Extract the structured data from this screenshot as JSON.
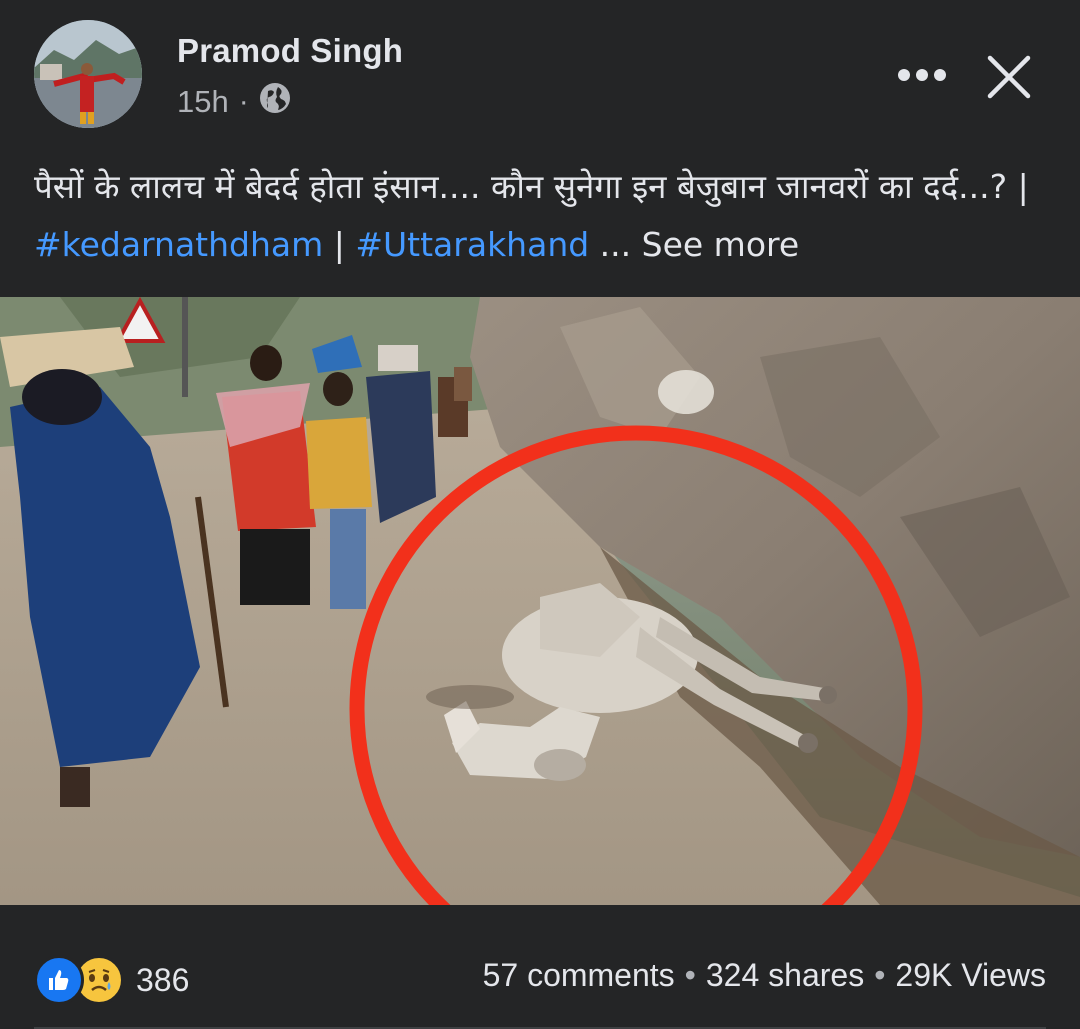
{
  "post": {
    "author": "Pramod Singh",
    "time": "15h",
    "meta_separator": "·",
    "audience_icon": "globe-icon",
    "more_icon": "more-options-icon",
    "close_icon": "close-icon",
    "caption": {
      "text": "पैसों के लालच में बेदर्द होता इंसान.... कौन सुनेगा इन बेजुबान जानवरों का दर्द...? | ",
      "hashtag1": "#kedarnathdham",
      "separator": "  | ",
      "hashtag2": "#Uttarakhand",
      "ellipsis": " ... ",
      "see_more": "See more"
    }
  },
  "footer": {
    "reaction_icons": [
      "like-icon",
      "sad-icon"
    ],
    "reaction_count": "386",
    "comments": "57 comments",
    "dot1": "•",
    "shares": "324 shares",
    "dot2": "•",
    "views": "29K Views"
  },
  "colors": {
    "background": "#242526",
    "text": "#e4e6eb",
    "secondary_text": "#b0b3b8",
    "hashtag": "#4599ff",
    "like_blue": "#1877f2",
    "highlight_circle": "#f2301b"
  }
}
